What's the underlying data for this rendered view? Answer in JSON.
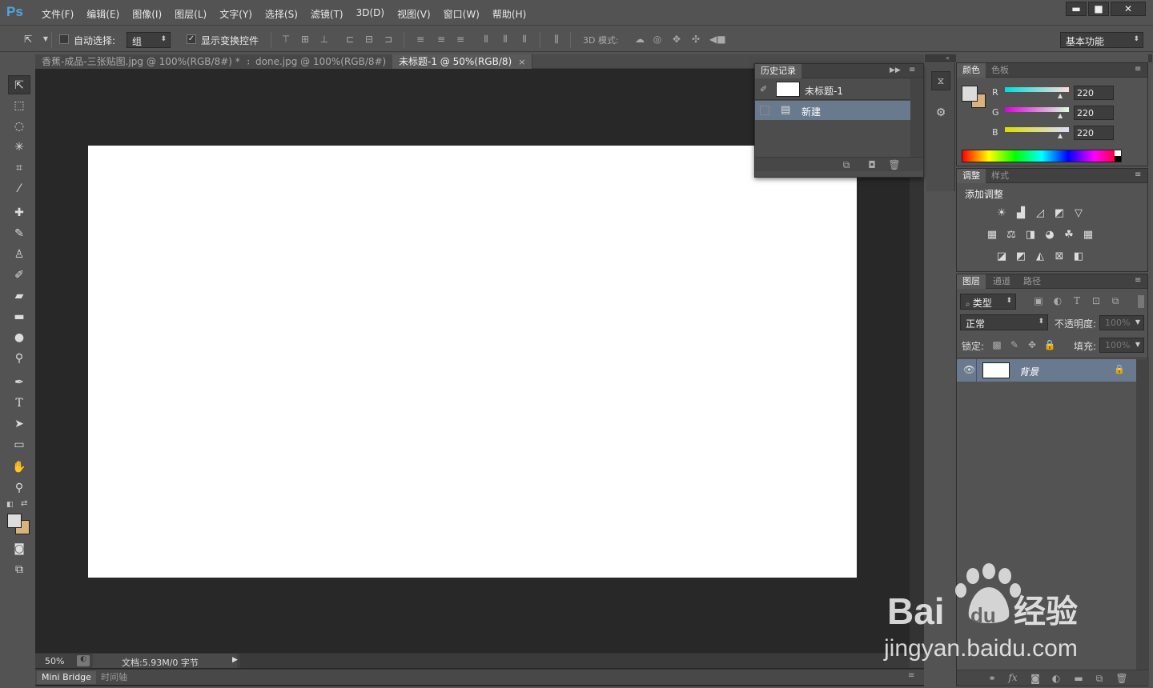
{
  "app": {
    "logo": "Ps"
  },
  "menubar": {
    "items": [
      "文件(F)",
      "编辑(E)",
      "图像(I)",
      "图层(L)",
      "文字(Y)",
      "选择(S)",
      "滤镜(T)",
      "3D(D)",
      "视图(V)",
      "窗口(W)",
      "帮助(H)"
    ],
    "minimize": "▬",
    "restore": "■",
    "close": "✕"
  },
  "options": {
    "auto_select_label": "自动选择:",
    "auto_select_value": "组",
    "show_transform_label": "显示变换控件",
    "mode3d_label": "3D 模式:",
    "workspace": "基本功能"
  },
  "tabs": [
    {
      "label": "香蕉-成品-三张贴图.jpg @ 100%(RGB/8#) *",
      "active": false
    },
    {
      "label": "done.jpg @ 100%(RGB/8#)",
      "active": false
    },
    {
      "label": "未标题-1 @ 50%(RGB/8)",
      "active": true
    }
  ],
  "tab_close": "×",
  "status": {
    "zoom": "50%",
    "doc": "文档:5.93M/0 字节",
    "arrow": "▶"
  },
  "bottom_tabs": [
    "Mini Bridge",
    "时间轴"
  ],
  "history": {
    "tab": "历史记录",
    "snapshot": "未标题-1",
    "step": "新建"
  },
  "color_panel": {
    "tabs": [
      "颜色",
      "色板"
    ],
    "channels": [
      {
        "label": "R",
        "value": "220"
      },
      {
        "label": "G",
        "value": "220"
      },
      {
        "label": "B",
        "value": "220"
      }
    ],
    "fg_color": "#dcdcdc",
    "bg_color": "#d9b27c"
  },
  "adjust_panel": {
    "tabs": [
      "调整",
      "样式"
    ],
    "title": "添加调整"
  },
  "layers_panel": {
    "tabs": [
      "图层",
      "通道",
      "路径"
    ],
    "filter": "类型",
    "blend_mode": "正常",
    "opacity_label": "不透明度:",
    "opacity_value": "100%",
    "lock_label": "锁定:",
    "fill_label": "填充:",
    "fill_value": "100%",
    "layer_name": "背景"
  },
  "watermark": {
    "brand": "Bai du 经验",
    "url": "jingyan.baidu.com"
  }
}
